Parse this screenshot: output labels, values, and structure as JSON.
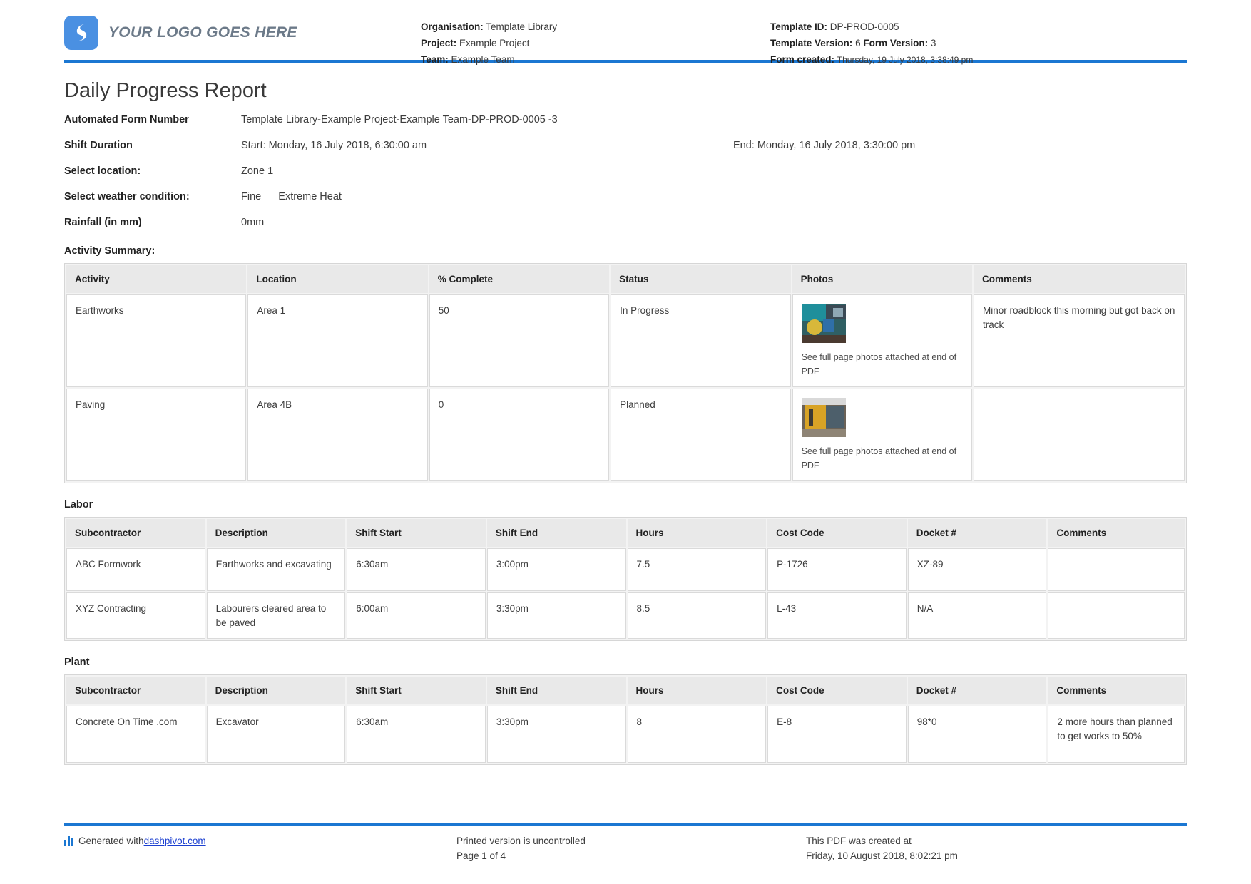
{
  "header": {
    "logo_text": "YOUR LOGO GOES HERE",
    "organisation_label": "Organisation:",
    "organisation_value": "Template Library",
    "project_label": "Project:",
    "project_value": "Example Project",
    "team_label": "Team:",
    "team_value": "Example Team",
    "template_id_label": "Template ID:",
    "template_id_value": "DP-PROD-0005",
    "template_version_label": "Template Version:",
    "template_version_value": "6",
    "form_version_label": "Form Version:",
    "form_version_value": "3",
    "form_created_label": "Form created:",
    "form_created_value": "Thursday, 19 July 2018, 3:38:49 pm"
  },
  "title": "Daily Progress Report",
  "fields": {
    "automated_form_number_label": "Automated Form Number",
    "automated_form_number_value": "Template Library-Example Project-Example Team-DP-PROD-0005   -3",
    "shift_duration_label": "Shift Duration",
    "shift_start_value": "Start: Monday, 16 July 2018, 6:30:00 am",
    "shift_end_value": "End: Monday, 16 July 2018, 3:30:00 pm",
    "location_label": "Select location:",
    "location_value": "Zone 1",
    "weather_label": "Select weather condition:",
    "weather_value_1": "Fine",
    "weather_value_2": "Extreme Heat",
    "rainfall_label": "Rainfall (in mm)",
    "rainfall_value": "0mm"
  },
  "activity_summary": {
    "title": "Activity Summary:",
    "columns": [
      "Activity",
      "Location",
      "% Complete",
      "Status",
      "Photos",
      "Comments"
    ],
    "rows": [
      {
        "activity": "Earthworks",
        "location": "Area 1",
        "percent_complete": "50",
        "status": "In Progress",
        "photo_caption": "See full page photos attached at end of PDF",
        "comments": "Minor roadblock this morning but got back on track"
      },
      {
        "activity": "Paving",
        "location": "Area 4B",
        "percent_complete": "0",
        "status": "Planned",
        "photo_caption": "See full page photos attached at end of PDF",
        "comments": ""
      }
    ]
  },
  "labor": {
    "title": "Labor",
    "columns": [
      "Subcontractor",
      "Description",
      "Shift Start",
      "Shift End",
      "Hours",
      "Cost Code",
      "Docket #",
      "Comments"
    ],
    "rows": [
      {
        "subcontractor": "ABC Formwork",
        "description": "Earthworks and excavating",
        "shift_start": "6:30am",
        "shift_end": "3:00pm",
        "hours": "7.5",
        "cost_code": "P-1726",
        "docket": "XZ-89",
        "comments": ""
      },
      {
        "subcontractor": "XYZ Contracting",
        "description": "Labourers cleared area to be paved",
        "shift_start": "6:00am",
        "shift_end": "3:30pm",
        "hours": "8.5",
        "cost_code": "L-43",
        "docket": "N/A",
        "comments": ""
      }
    ]
  },
  "plant": {
    "title": "Plant",
    "columns": [
      "Subcontractor",
      "Description",
      "Shift Start",
      "Shift End",
      "Hours",
      "Cost Code",
      "Docket #",
      "Comments"
    ],
    "rows": [
      {
        "subcontractor": "Concrete On Time .com",
        "description": "Excavator",
        "shift_start": "6:30am",
        "shift_end": "3:30pm",
        "hours": "8",
        "cost_code": "E-8",
        "docket": "98*0",
        "comments": "2 more hours than planned to get works to 50%"
      }
    ]
  },
  "footer": {
    "generated_with": "Generated with ",
    "generated_link": "dashpivot.com",
    "printed_notice": "Printed version is uncontrolled",
    "page_number": "Page 1 of 4",
    "created_label": "This PDF was created at",
    "created_value": "Friday, 10 August 2018, 8:02:21 pm"
  },
  "colors": {
    "accent_blue": "#1b77d2",
    "logo_blue": "#4a90e2",
    "header_gray": "#e9e9e9"
  }
}
